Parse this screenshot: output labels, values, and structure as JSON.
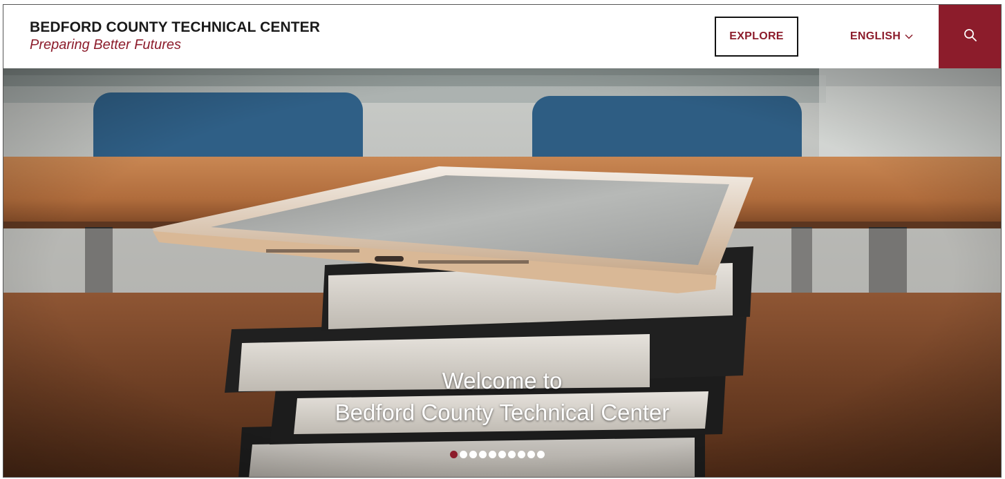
{
  "header": {
    "site_name": "BEDFORD COUNTY TECHNICAL CENTER",
    "tagline": "Preparing Better Futures",
    "explore_label": "EXPLORE",
    "language_label": "ENGLISH",
    "search_icon": "search-icon",
    "language_chevron_icon": "chevron-down-icon"
  },
  "hero": {
    "headline_line1": "Welcome to",
    "headline_line2": "Bedford County Technical Center",
    "slide_count": 10,
    "active_slide": 1
  },
  "colors": {
    "brand": "#8c1c2b",
    "text_dark": "#1a1a1a",
    "white": "#ffffff"
  }
}
